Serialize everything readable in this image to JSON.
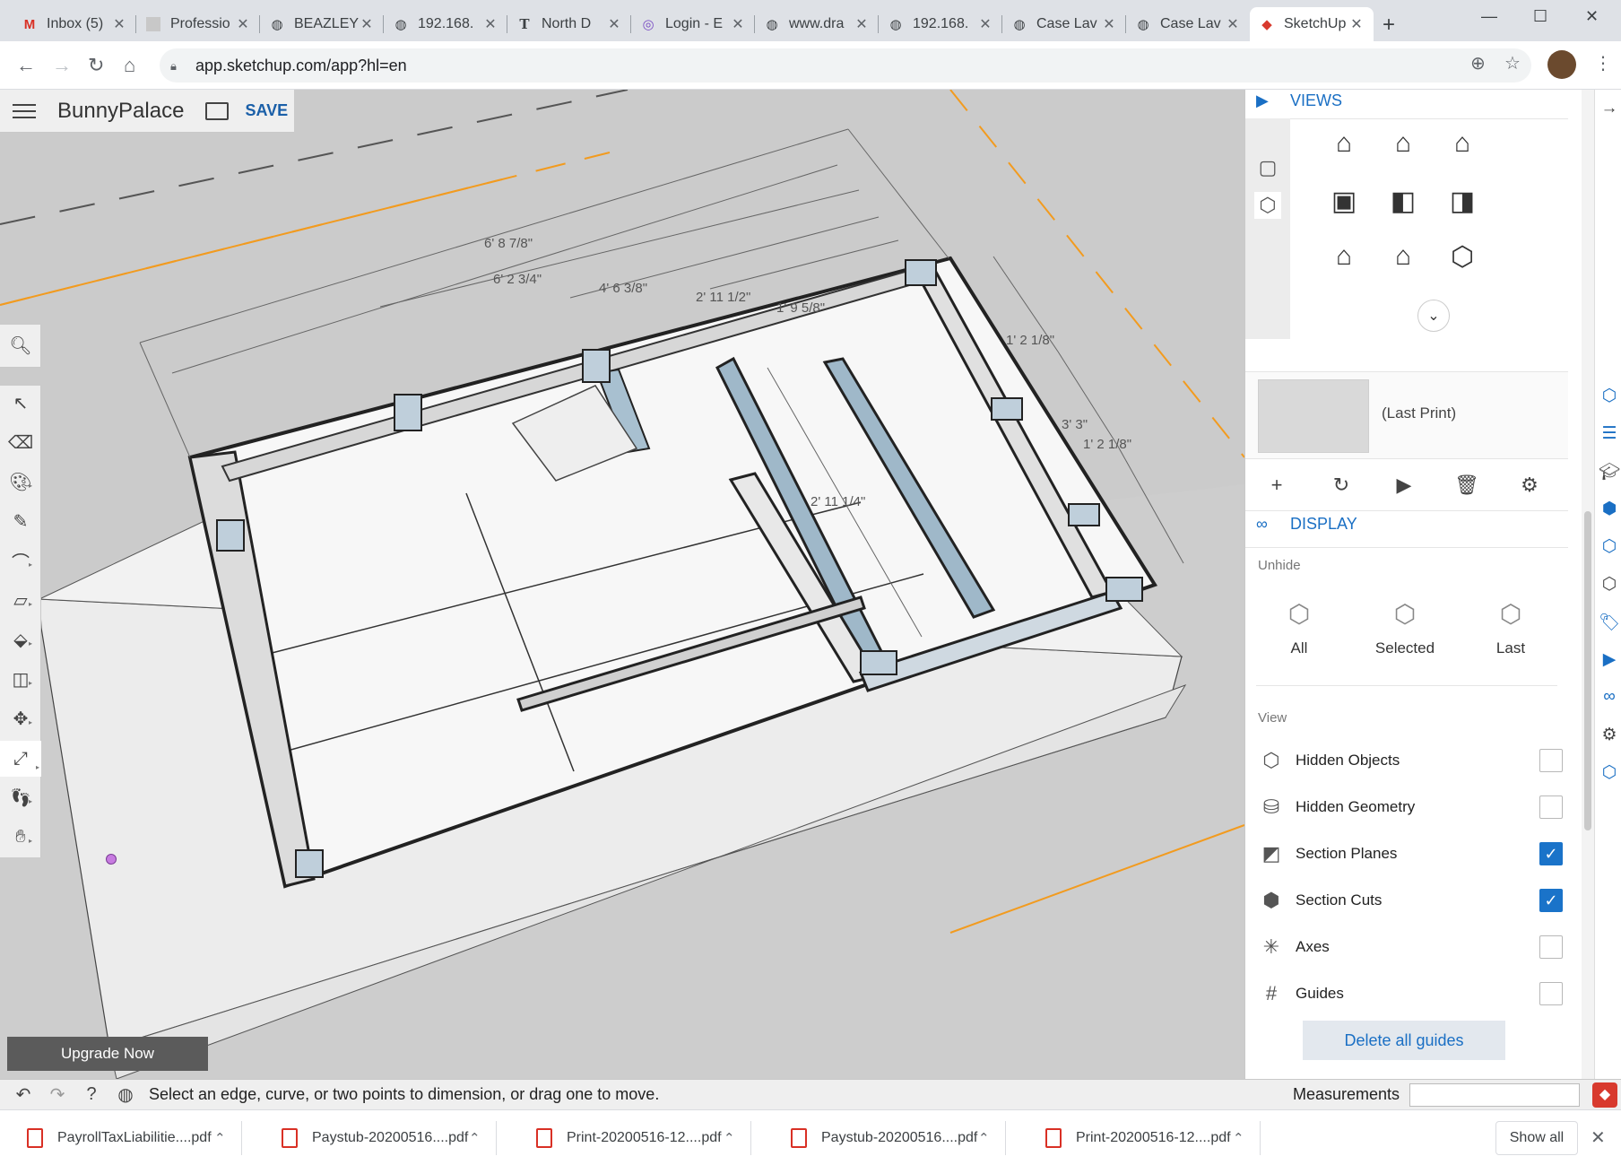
{
  "browser": {
    "tabs": [
      {
        "title": "Inbox (5)",
        "icon": "gmail-icon"
      },
      {
        "title": "Professio",
        "icon": "page-icon"
      },
      {
        "title": "BEAZLEY",
        "icon": "globe-icon"
      },
      {
        "title": "192.168.",
        "icon": "globe-icon"
      },
      {
        "title": "North D",
        "icon": "nyt-icon"
      },
      {
        "title": "Login - E",
        "icon": "circle-icon"
      },
      {
        "title": "www.dra",
        "icon": "globe-icon"
      },
      {
        "title": "192.168.",
        "icon": "globe-icon"
      },
      {
        "title": "Case Lav",
        "icon": "globe-icon"
      },
      {
        "title": "Case Lav",
        "icon": "globe-icon"
      },
      {
        "title": "SketchUp",
        "icon": "sketchup-icon",
        "active": true
      }
    ],
    "url": "app.sketchup.com/app?hl=en"
  },
  "app": {
    "project_name": "BunnyPalace",
    "save_label": "SAVE",
    "upgrade_label": "Upgrade Now"
  },
  "dimensions": [
    "6' 8 7/8\"",
    "6' 2 3/4\"",
    "4' 6 3/8\"",
    "2' 11 1/2\"",
    "1' 9 5/8\"",
    "1' 2 1/8\"",
    "3' 3\"",
    "1' 2 1/8\"",
    "2' 11 1/4\""
  ],
  "panel": {
    "views_title": "VIEWS",
    "scene_label": "(Last Print)",
    "display_title": "DISPLAY",
    "unhide_label": "Unhide",
    "unhide_buttons": [
      "All",
      "Selected",
      "Last"
    ],
    "view_label": "View",
    "view_options": [
      {
        "label": "Hidden Objects",
        "checked": false
      },
      {
        "label": "Hidden Geometry",
        "checked": false
      },
      {
        "label": "Section Planes",
        "checked": true
      },
      {
        "label": "Section Cuts",
        "checked": true
      },
      {
        "label": "Axes",
        "checked": false
      },
      {
        "label": "Guides",
        "checked": false
      }
    ],
    "delete_guides_label": "Delete all guides"
  },
  "status": {
    "message": "Select an edge, curve, or two points to dimension, or drag one to move.",
    "measurements_label": "Measurements"
  },
  "downloads": [
    "PayrollTaxLiabilitie....pdf",
    "Paystub-20200516....pdf",
    "Print-20200516-12....pdf",
    "Paystub-20200516....pdf",
    "Print-20200516-12....pdf"
  ],
  "downloads_show_all": "Show all"
}
